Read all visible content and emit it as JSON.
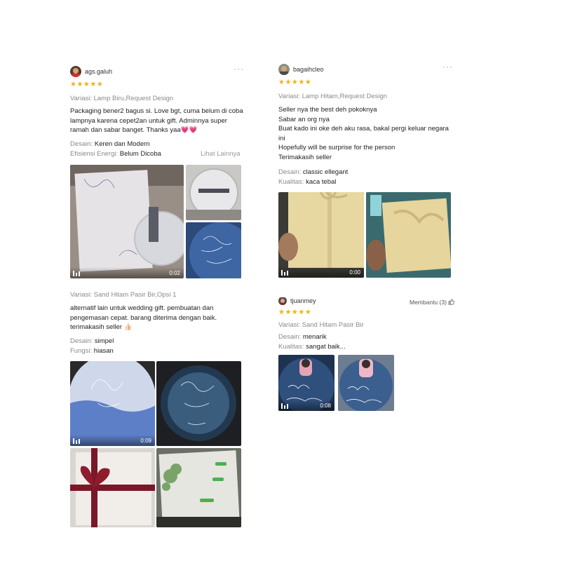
{
  "reviews": [
    {
      "username": "ags.galuh",
      "more_icon": "more-dots-icon",
      "stars": "★★★★★",
      "variant": "Variasi: Lamp Biru,Request Design",
      "text": "Packaging bener2 bagus si. Love bgt, cuma belum di coba\nlampnya karena cepet2an untuk gift. Adminnya super\nramah dan sabar banget. Thanks yaa💗💗",
      "attrs": [
        {
          "label": "Desain:",
          "value": "Keren dan Modern"
        },
        {
          "label": "Efisiensi Energi:",
          "value": "Belum Dicoba"
        }
      ],
      "see_more": "Lihat Lainnya",
      "media": [
        {
          "type": "video",
          "duration": "0:02"
        },
        {
          "type": "image"
        },
        {
          "type": "image"
        }
      ]
    },
    {
      "username": "bagaihcleo",
      "more_icon": "more-dots-icon",
      "stars": "★★★★★",
      "variant": "Variasi: Lamp Hitam,Request Design",
      "text": "Seller nya the best deh pokoknya\nSabar an org nya\nBuat kado ini oke deh aku rasa, bakal pergi keluar negara\nini\nHopefully will be surprise for the person\nTerimakasih seller",
      "attrs": [
        {
          "label": "Desain:",
          "value": "classic ellegant"
        },
        {
          "label": "Kualitas:",
          "value": "kaca tebal"
        }
      ],
      "media": [
        {
          "type": "video",
          "duration": "0:00"
        },
        {
          "type": "image"
        }
      ]
    },
    {
      "variant": "Variasi: Sand Hitam Pasir Bir,Opsi 1",
      "text": "alternatif lain untuk wedding gift. pembuatan dan\npengemasan cepat. barang diterima dengan baik.\nterimakasih seller 👍🏻",
      "attrs": [
        {
          "label": "Desain:",
          "value": "simpel"
        },
        {
          "label": "Fungsi:",
          "value": "hiasan"
        }
      ],
      "media": [
        {
          "type": "video",
          "duration": "0:09"
        },
        {
          "type": "image"
        },
        {
          "type": "image"
        },
        {
          "type": "image"
        }
      ]
    },
    {
      "username": "tjuanmey",
      "helpful": "Membantu (3)",
      "helpful_icon": "thumbs-up-icon",
      "stars": "★★★★★",
      "variant": "Variasi: Sand Hitam Pasir Bir",
      "attrs": [
        {
          "label": "Desain:",
          "value": "menarik"
        },
        {
          "label": "Kualitas:",
          "value": "sangat baik..."
        }
      ],
      "media": [
        {
          "type": "video",
          "duration": "0:08"
        },
        {
          "type": "image"
        }
      ]
    }
  ],
  "colors": {
    "star": "#f5b301",
    "muted_text": "#8a8a8a",
    "body_text": "#222222"
  }
}
